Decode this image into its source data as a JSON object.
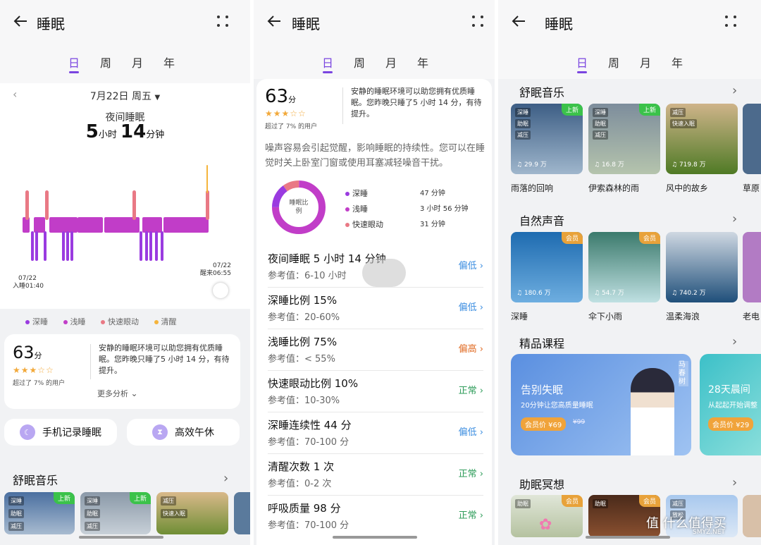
{
  "header": {
    "title": "睡眠",
    "tabs": [
      "日",
      "周",
      "月",
      "年"
    ]
  },
  "panel1": {
    "date": "7月22日 周五",
    "night_label": "夜间睡眠",
    "duration": {
      "h": "5",
      "h_unit": "小时",
      "m": "14",
      "m_unit": "分钟"
    },
    "start": {
      "date": "07/22",
      "label": "入睡01:40"
    },
    "end": {
      "date": "07/22",
      "label": "醒来06:55"
    },
    "legend": [
      "深睡",
      "浅睡",
      "快速眼动",
      "清醒"
    ],
    "score": {
      "value": "63",
      "unit": "分",
      "stars": "★★★☆☆",
      "pct": "超过了 7% 的用户",
      "text": "安静的睡眠环境可以助您拥有优质睡眠。您昨晚只睡了5 小时 14 分，有待提升。",
      "more": "更多分析"
    },
    "buttons": [
      "手机记录睡眠",
      "高效午休"
    ],
    "music_title": "舒眠音乐",
    "music": [
      {
        "tags": [
          "深睡",
          "助眠",
          "减压"
        ],
        "badge": "上新"
      },
      {
        "tags": [
          "深睡",
          "助眠",
          "减压"
        ],
        "badge": "上新"
      },
      {
        "tags": [
          "减压",
          "快速入眠"
        ],
        "badge": ""
      }
    ]
  },
  "panel2": {
    "score": {
      "value": "63",
      "unit": "分",
      "stars": "★★★☆☆",
      "pct": "超过了 7% 的用户",
      "text": "安静的睡眠环境可以助您拥有优质睡眠。您昨晚只睡了5 小时 14 分，有待提升。"
    },
    "noise": "噪声容易会引起觉醒，影响睡眠的持续性。您可以在睡觉时关上卧室门窗或使用耳塞减轻噪音干扰。",
    "donut": {
      "label": "睡眠比例",
      "deep": 15,
      "light": 75,
      "rem": 10
    },
    "ratio": [
      {
        "name": "深睡",
        "val": "47 分钟"
      },
      {
        "name": "浅睡",
        "val": "3 小时 56 分钟"
      },
      {
        "name": "快速眼动",
        "val": "31 分钟"
      }
    ],
    "rows": [
      {
        "name": "夜间睡眠  5 小时 14 分钟",
        "ref": "参考值：6-10 小时",
        "status": "偏低",
        "cls": "lowc"
      },
      {
        "name": "深睡比例  15%",
        "ref": "参考值：20-60%",
        "status": "偏低",
        "cls": "lowc"
      },
      {
        "name": "浅睡比例  75%",
        "ref": "参考值：< 55%",
        "status": "偏高",
        "cls": "highc"
      },
      {
        "name": "快速眼动比例  10%",
        "ref": "参考值：10-30%",
        "status": "正常",
        "cls": "okc"
      },
      {
        "name": "深睡连续性  44 分",
        "ref": "参考值：70-100 分",
        "status": "偏低",
        "cls": "lowc"
      },
      {
        "name": "清醒次数  1 次",
        "ref": "参考值：0-2 次",
        "status": "正常",
        "cls": "okc"
      },
      {
        "name": "呼吸质量  98 分",
        "ref": "参考值：70-100 分",
        "status": "正常",
        "cls": "okc"
      }
    ]
  },
  "panel3": {
    "sections": [
      "舒眠音乐",
      "自然声音",
      "精品课程",
      "助眠冥想"
    ],
    "music": [
      {
        "tags": [
          "深睡",
          "助眠",
          "减压"
        ],
        "badge": "上新",
        "count": "29.9 万",
        "name": "雨落的回响"
      },
      {
        "tags": [
          "深睡",
          "助眠",
          "减压"
        ],
        "badge": "上新",
        "count": "16.8 万",
        "name": "伊索森林的雨"
      },
      {
        "tags": [
          "减压",
          "快速入眠"
        ],
        "badge": "",
        "count": "719.8 万",
        "name": "风中的故乡"
      },
      {
        "tags": [
          "失"
        ],
        "badge": "",
        "count": "",
        "name": "草原"
      }
    ],
    "nature": [
      {
        "badge": "会员",
        "count": "180.6 万",
        "name": "深睡"
      },
      {
        "badge": "会员",
        "count": "54.7 万",
        "name": "伞下小雨"
      },
      {
        "badge": "",
        "count": "740.2 万",
        "name": "温柔海浪"
      },
      {
        "badge": "",
        "count": "",
        "name": "老电"
      }
    ],
    "course1": {
      "title": "告别失眠",
      "sub": "20分钟让您高质量睡眠",
      "price": "会员价 ¥69",
      "orig": "¥99",
      "teacher": "马春树"
    },
    "course2": {
      "title": "28天晨间",
      "sub": "从起起开始调整",
      "price": "会员价 ¥29"
    },
    "meditation": [
      {
        "tags": [
          "助眠"
        ],
        "badge": "会员"
      },
      {
        "tags": [
          "助眠"
        ],
        "badge": "会员"
      },
      {
        "tags": [
          "减压",
          "放松"
        ],
        "badge": ""
      }
    ]
  },
  "watermark": "值 什么值得买",
  "watermark_sub": "SMYZ.NET"
}
